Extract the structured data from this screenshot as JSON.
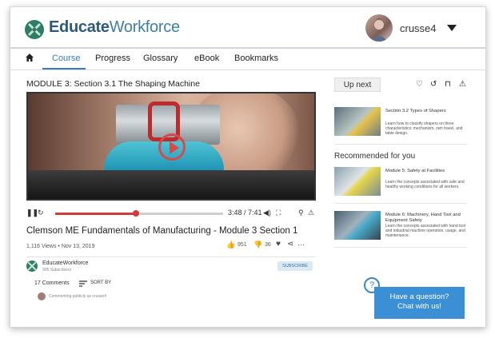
{
  "header": {
    "brand_bold": "Educate",
    "brand_rest": "Workforce",
    "username": "crusse4"
  },
  "nav": {
    "items": [
      "Course",
      "Progress",
      "Glossary",
      "eBook",
      "Bookmarks"
    ],
    "active": "Course"
  },
  "video": {
    "module_title": "MODULE 3: Section 3.1 The Shaping Machine",
    "time": "3:48 / 7:41",
    "progress": 0.48,
    "heading": "Clemson ME Fundamentals of Manufacturing - Module 3 Section 1",
    "meta": "1,116 Views • Nov 13, 2019",
    "likes": "951",
    "dislikes": "36"
  },
  "channel": {
    "name": "EducateWorkforce",
    "subs": "905 Subscribers",
    "subscribe": "SUBSCRIBE"
  },
  "comments": {
    "count": "17 Comments",
    "sort": "SORT BY",
    "commenting_as": "Commenting publicly as crusse4"
  },
  "sidebar": {
    "up_next": "Up next",
    "recommended_heading": "Recommended for you",
    "cards": [
      {
        "title": "Section 3.2 Types of Shapers",
        "desc": "Learn how to classify shapers on three characteristics: mechanism, ram travel, and table design."
      },
      {
        "title": "Module 5: Safety at Facilities",
        "desc": "Learn the concepts associated with safe and healthy working conditions for all workers."
      },
      {
        "title": "Module 6: Machinery, Hand Tool and Equipment Safety",
        "desc": "Learn the concepts associated with hand tool and industrial machine operation, usage, and maintenance."
      }
    ]
  },
  "help": {
    "question_mark": "?",
    "chat_line1": "Have a question?",
    "chat_line2": "Chat with us!"
  },
  "colors": {
    "brand_green": "#2e7d64",
    "accent_blue": "#3a7bbf",
    "progress_red": "#d23b3b",
    "chat_blue": "#3b8fd5"
  }
}
